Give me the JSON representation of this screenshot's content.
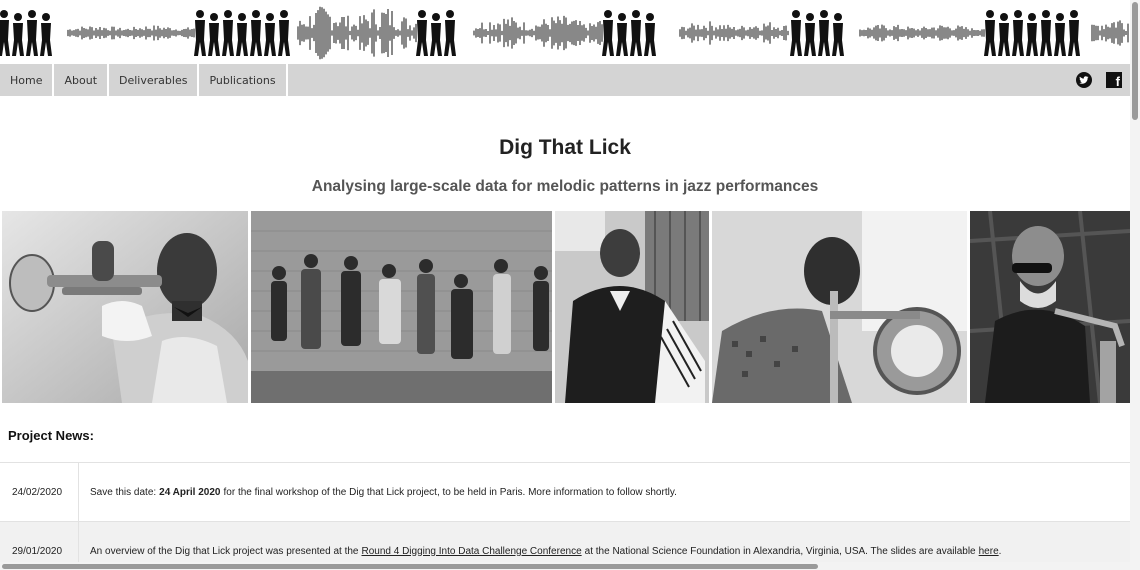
{
  "nav": {
    "items": [
      {
        "label": "Home"
      },
      {
        "label": "About"
      },
      {
        "label": "Deliverables"
      },
      {
        "label": "Publications"
      }
    ],
    "social": [
      "twitter-icon",
      "facebook-icon"
    ]
  },
  "header": {
    "title": "Dig That Lick",
    "subtitle": "Analysing large-scale data for melodic patterns in jazz performances"
  },
  "banner": {
    "description_icon": "jazz-silhouette-waveform-banner"
  },
  "photos": [
    {
      "icon": "trumpeter-photo"
    },
    {
      "icon": "street-band-photo"
    },
    {
      "icon": "pianist-photo"
    },
    {
      "icon": "trombonist-photo"
    },
    {
      "icon": "saxophonist-photo"
    }
  ],
  "news": {
    "heading": "Project News:",
    "rows": [
      {
        "date": "24/02/2020",
        "pre": "Save this date:",
        "bold": "24 April 2020",
        "post": "for the final workshop of the Dig that Lick project, to be held in Paris. More information to follow shortly."
      },
      {
        "date": "29/01/2020",
        "pre": "An overview of the Dig that Lick project was presented at the",
        "link": "Round 4 Digging Into Data Challenge Conference",
        "mid": "at the National Science Foundation in Alexandria, Virginia, USA. The slides are available",
        "link2": "here",
        "post": "."
      }
    ]
  },
  "colors": {
    "nav_bg": "#d4d4d4",
    "row_alt": "#f1f1f1",
    "subtitle": "#555555"
  }
}
